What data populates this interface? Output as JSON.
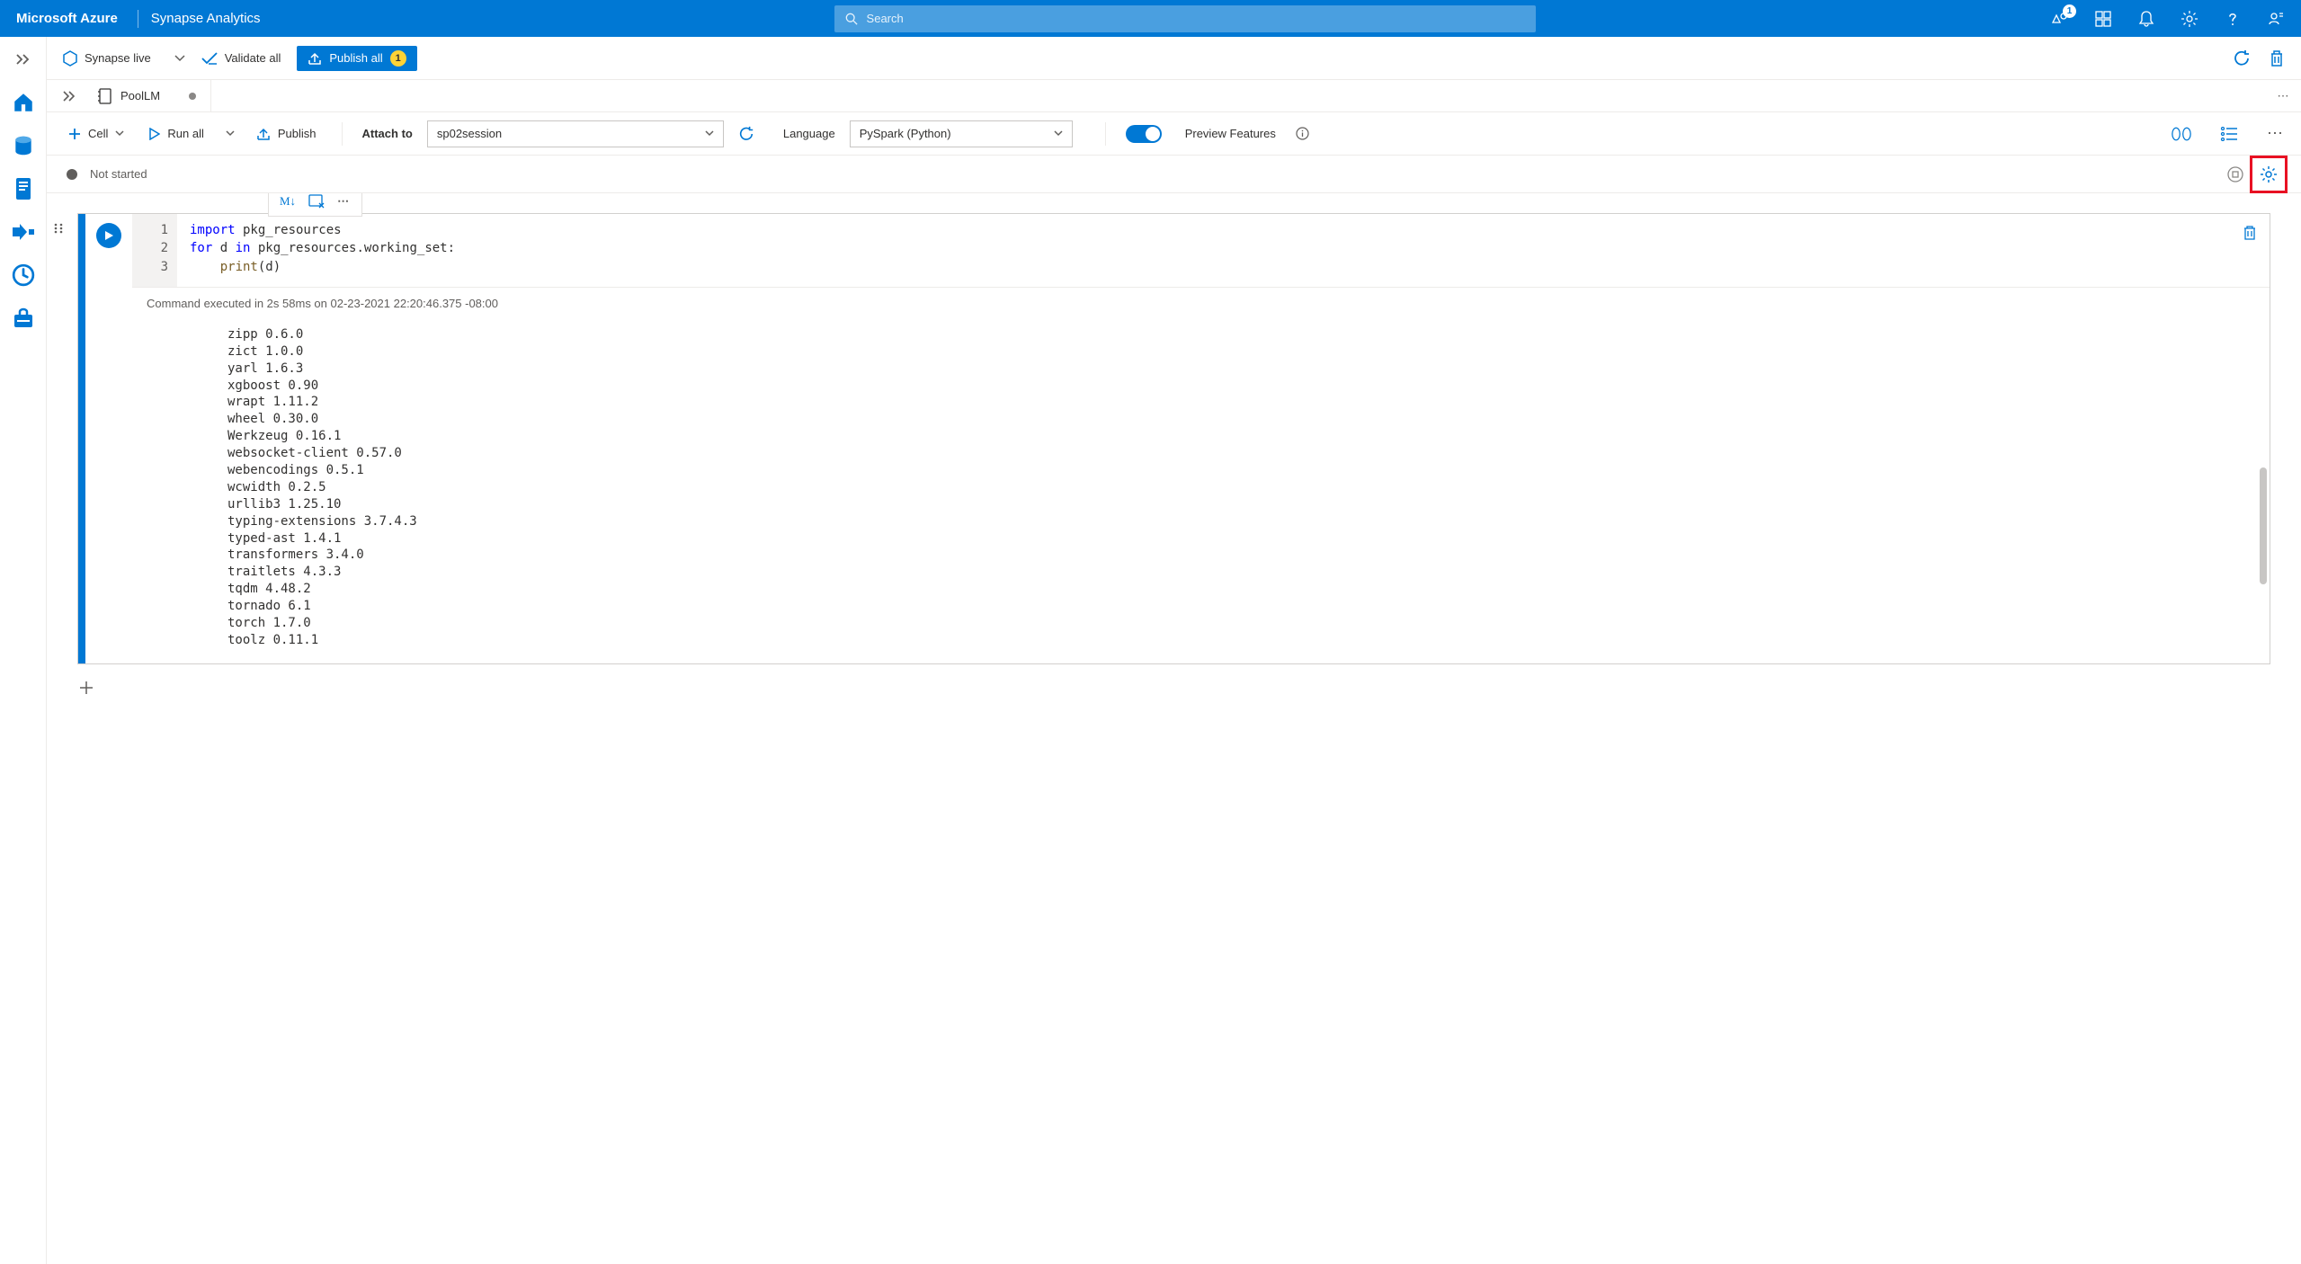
{
  "header": {
    "brand_ms": "Microsoft Azure",
    "brand_service": "Synapse Analytics",
    "search_placeholder": "Search",
    "notification_badge": "1"
  },
  "toolbar1": {
    "synapse_live": "Synapse live",
    "validate_all": "Validate all",
    "publish_all": "Publish all",
    "publish_count": "1"
  },
  "tab": {
    "name": "PoolLM"
  },
  "nb_toolbar": {
    "cell_label": "Cell",
    "run_all": "Run all",
    "publish": "Publish",
    "attach_to_label": "Attach to",
    "attach_value": "sp02session",
    "language_label": "Language",
    "language_value": "PySpark (Python)",
    "preview_label": "Preview Features"
  },
  "status": {
    "text": "Not started"
  },
  "cell": {
    "toolbar_md": "M↓",
    "line_numbers": [
      "1",
      "2",
      "3"
    ],
    "code_line1_kw": "import",
    "code_line1_rest": " pkg_resources",
    "code_line2_for": "for",
    "code_line2_d": " d ",
    "code_line2_in": "in",
    "code_line2_rest": " pkg_resources.working_set:",
    "code_line3_indent": "    ",
    "code_line3_fn": "print",
    "code_line3_rest": "(d)",
    "exec_info": "Command executed in 2s 58ms on 02-23-2021 22:20:46.375 -08:00",
    "output_text": "zipp 0.6.0\nzict 1.0.0\nyarl 1.6.3\nxgboost 0.90\nwrapt 1.11.2\nwheel 0.30.0\nWerkzeug 0.16.1\nwebsocket-client 0.57.0\nwebencodings 0.5.1\nwcwidth 0.2.5\nurllib3 1.25.10\ntyping-extensions 3.7.4.3\ntyped-ast 1.4.1\ntransformers 3.4.0\ntraitlets 4.3.3\ntqdm 4.48.2\ntornado 6.1\ntorch 1.7.0\ntoolz 0.11.1"
  }
}
